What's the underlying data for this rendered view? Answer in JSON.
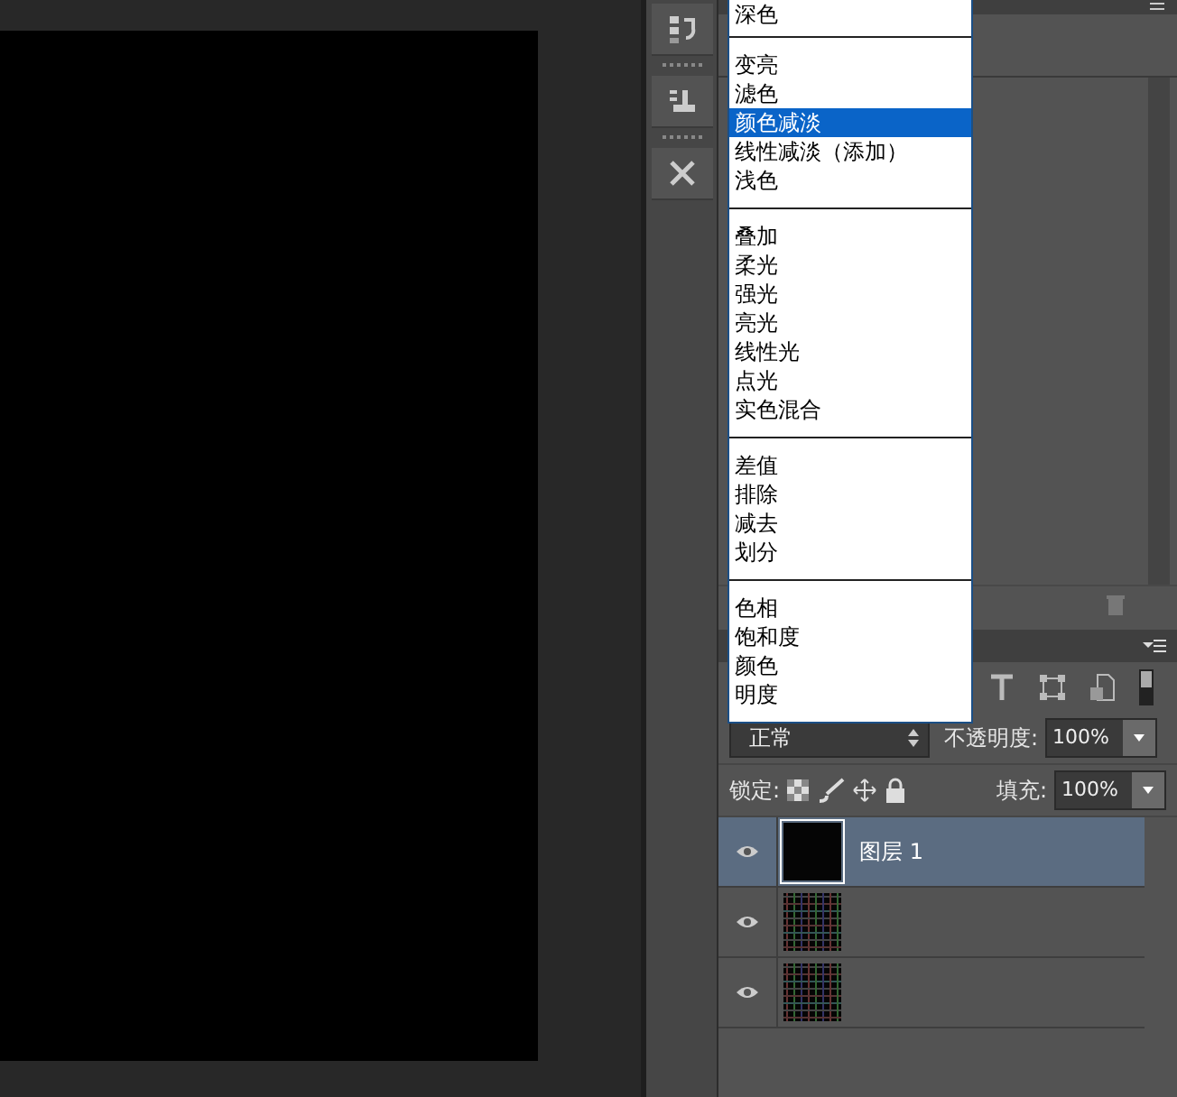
{
  "blend_menu": {
    "groups": [
      [
        {
          "label": "深色",
          "selected": false
        }
      ],
      [
        {
          "label": "变亮",
          "selected": false
        },
        {
          "label": "滤色",
          "selected": false
        },
        {
          "label": "颜色减淡",
          "selected": true
        },
        {
          "label": "线性减淡（添加）",
          "selected": false
        },
        {
          "label": "浅色",
          "selected": false
        }
      ],
      [
        {
          "label": "叠加",
          "selected": false
        },
        {
          "label": "柔光",
          "selected": false
        },
        {
          "label": "强光",
          "selected": false
        },
        {
          "label": "亮光",
          "selected": false
        },
        {
          "label": "线性光",
          "selected": false
        },
        {
          "label": "点光",
          "selected": false
        },
        {
          "label": "实色混合",
          "selected": false
        }
      ],
      [
        {
          "label": "差值",
          "selected": false
        },
        {
          "label": "排除",
          "selected": false
        },
        {
          "label": "减去",
          "selected": false
        },
        {
          "label": "划分",
          "selected": false
        }
      ],
      [
        {
          "label": "色相",
          "selected": false
        },
        {
          "label": "饱和度",
          "selected": false
        },
        {
          "label": "颜色",
          "selected": false
        },
        {
          "label": "明度",
          "selected": false
        }
      ]
    ]
  },
  "layers_panel": {
    "blend_mode": "正常",
    "opacity_label": "不透明度:",
    "opacity": "100%",
    "lock_label": "锁定:",
    "fill_label": "填充:",
    "fill": "100%",
    "layers": [
      {
        "name": "图层 1",
        "selected": true,
        "visible": true,
        "kind": "solid"
      },
      {
        "selected": false,
        "visible": true,
        "kind": "grid"
      },
      {
        "selected": false,
        "visible": true,
        "kind": "grid"
      }
    ]
  }
}
